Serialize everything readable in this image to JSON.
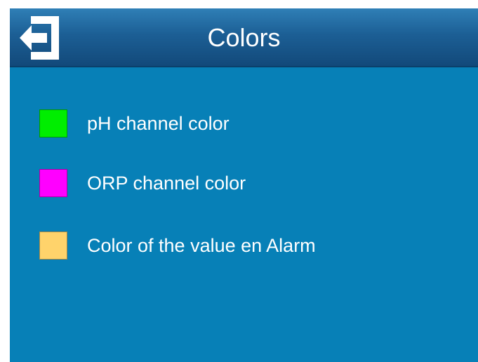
{
  "header": {
    "title": "Colors",
    "back_icon": "exit-arrow-icon"
  },
  "colors": {
    "screen_background": "#0780b7",
    "header_background": "#1c5f95",
    "text": "#ffffff"
  },
  "settings": [
    {
      "label": "pH channel color",
      "swatch_color": "#00ee00"
    },
    {
      "label": "ORP channel color",
      "swatch_color": "#ff00ff"
    },
    {
      "label": "Color of the value en Alarm",
      "swatch_color": "#ffd36b"
    }
  ]
}
